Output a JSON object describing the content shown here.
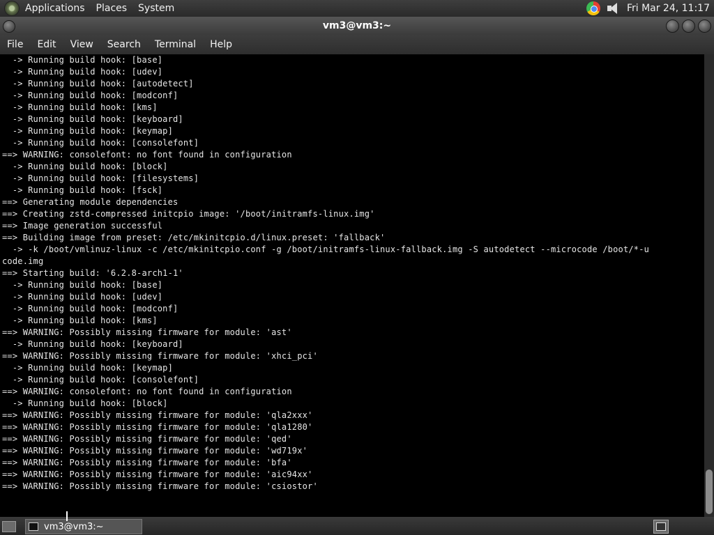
{
  "top_panel": {
    "menus": [
      "Applications",
      "Places",
      "System"
    ],
    "clock": "Fri Mar 24, 11:17",
    "icons": [
      "distro-logo-icon",
      "chrome-icon",
      "volume-icon"
    ]
  },
  "window": {
    "title": "vm3@vm3:~"
  },
  "menubar": {
    "items": [
      "File",
      "Edit",
      "View",
      "Search",
      "Terminal",
      "Help"
    ]
  },
  "terminal": {
    "lines": [
      "  -> Running build hook: [base]",
      "  -> Running build hook: [udev]",
      "  -> Running build hook: [autodetect]",
      "  -> Running build hook: [modconf]",
      "  -> Running build hook: [kms]",
      "  -> Running build hook: [keyboard]",
      "  -> Running build hook: [keymap]",
      "  -> Running build hook: [consolefont]",
      "==> WARNING: consolefont: no font found in configuration",
      "  -> Running build hook: [block]",
      "  -> Running build hook: [filesystems]",
      "  -> Running build hook: [fsck]",
      "==> Generating module dependencies",
      "==> Creating zstd-compressed initcpio image: '/boot/initramfs-linux.img'",
      "==> Image generation successful",
      "==> Building image from preset: /etc/mkinitcpio.d/linux.preset: 'fallback'",
      "  -> -k /boot/vmlinuz-linux -c /etc/mkinitcpio.conf -g /boot/initramfs-linux-fallback.img -S autodetect --microcode /boot/*-u",
      "code.img",
      "==> Starting build: '6.2.8-arch1-1'",
      "  -> Running build hook: [base]",
      "  -> Running build hook: [udev]",
      "  -> Running build hook: [modconf]",
      "  -> Running build hook: [kms]",
      "==> WARNING: Possibly missing firmware for module: 'ast'",
      "  -> Running build hook: [keyboard]",
      "==> WARNING: Possibly missing firmware for module: 'xhci_pci'",
      "  -> Running build hook: [keymap]",
      "  -> Running build hook: [consolefont]",
      "==> WARNING: consolefont: no font found in configuration",
      "  -> Running build hook: [block]",
      "==> WARNING: Possibly missing firmware for module: 'qla2xxx'",
      "==> WARNING: Possibly missing firmware for module: 'qla1280'",
      "==> WARNING: Possibly missing firmware for module: 'qed'",
      "==> WARNING: Possibly missing firmware for module: 'wd719x'",
      "==> WARNING: Possibly missing firmware for module: 'bfa'",
      "==> WARNING: Possibly missing firmware for module: 'aic94xx'",
      "==> WARNING: Possibly missing firmware for module: 'csiostor'"
    ]
  },
  "bottom_panel": {
    "taskbar_item": "vm3@vm3:~"
  }
}
